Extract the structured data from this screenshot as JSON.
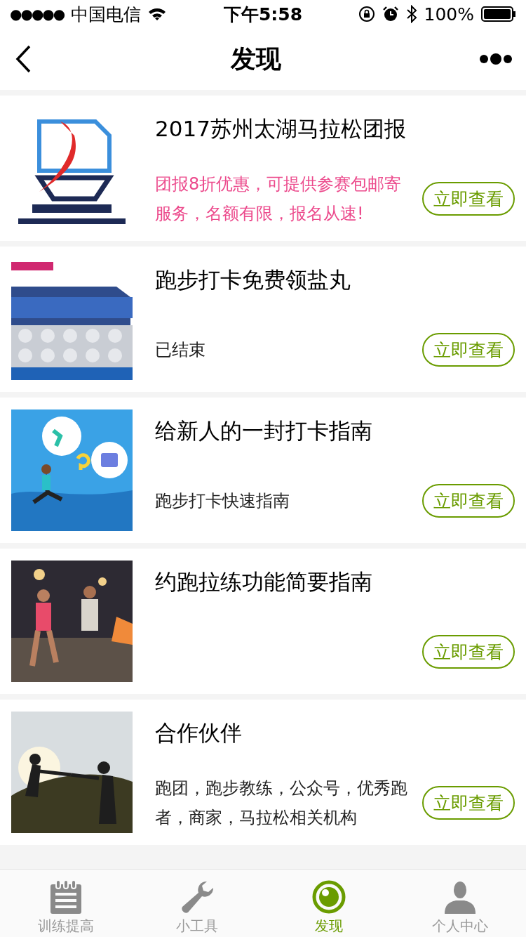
{
  "status_bar": {
    "signal": "●●●●●",
    "carrier": "中国电信",
    "time": "下午5:58",
    "battery": "100%"
  },
  "nav_bar": {
    "title": "发现"
  },
  "items": [
    {
      "title": "2017苏州太湖马拉松团报",
      "description": "团报8折优惠，可提供参赛包邮寄服务，名额有限，报名从速!",
      "color": "#ec4a8c",
      "button": "立即查看"
    },
    {
      "title": "跑步打卡免费领盐丸",
      "description": "已结束",
      "color": "#222222",
      "button": "立即查看"
    },
    {
      "title": "给新人的一封打卡指南",
      "description": "跑步打卡快速指南",
      "color": "#222222",
      "button": "立即查看"
    },
    {
      "title": "约跑拉练功能简要指南",
      "button": "立即查看"
    },
    {
      "title": "合作伙伴",
      "description": "跑团，跑步教练，公众号，优秀跑者，商家，马拉松相关机构",
      "color": "#222222",
      "button": "立即查看"
    }
  ],
  "tab_bar": [
    {
      "label": "训练提高",
      "kind": "notepad",
      "selected": false
    },
    {
      "label": "小工具",
      "kind": "wrench",
      "selected": false
    },
    {
      "label": "发现",
      "kind": "eye",
      "selected": true
    },
    {
      "label": "个人中心",
      "kind": "person",
      "selected": false
    }
  ]
}
